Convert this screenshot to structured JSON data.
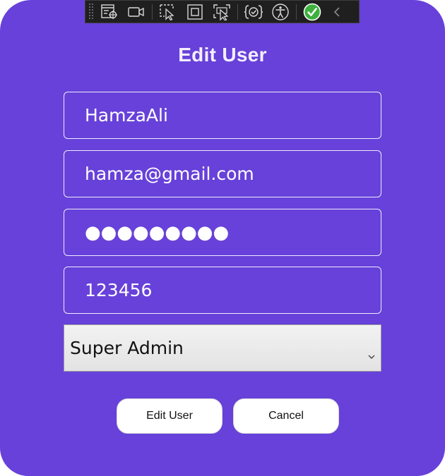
{
  "dialog": {
    "title": "Edit User"
  },
  "form": {
    "username": "HamzaAli",
    "email": "hamza@gmail.com",
    "password_mask": "●●●●●●●●●",
    "phone": "123456",
    "role_selected": "Super Admin"
  },
  "buttons": {
    "edit_label": "Edit User",
    "cancel_label": "Cancel"
  },
  "toolbar": {
    "icons": [
      "live-visual-tree-icon",
      "video-camera-icon",
      "select-element-icon",
      "display-layout-adorners-icon",
      "track-focus-icon",
      "binding-failures-icon",
      "accessibility-icon",
      "check-status-icon",
      "collapse-chevron-icon"
    ]
  },
  "colors": {
    "background": "#6741d9",
    "toolbar": "#1f1f1f",
    "check_green": "#3db03d"
  }
}
